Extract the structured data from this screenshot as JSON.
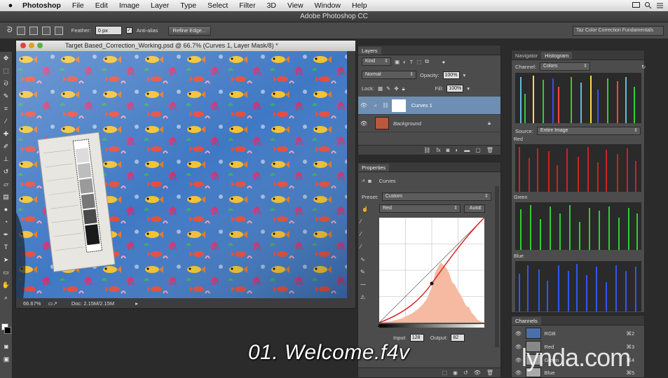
{
  "menubar": {
    "app": "Photoshop",
    "items": [
      "File",
      "Edit",
      "Image",
      "Layer",
      "Type",
      "Select",
      "Filter",
      "3D",
      "View",
      "Window",
      "Help"
    ]
  },
  "app_title": "Adobe Photoshop CC",
  "options": {
    "feather_label": "Feather:",
    "feather_value": "0 px",
    "antialias_label": "Anti-alias",
    "refine_edge": "Refine Edge...",
    "workspace": "Taz Color Correction Fundamentals"
  },
  "document": {
    "title": "Target Based_Correction_Working.psd @ 66.7% (Curves 1, Layer Mask/8) *",
    "zoom": "66.67%",
    "doc_size": "Doc: 2.15M/2.15M"
  },
  "layers": {
    "tab": "Layers",
    "kind": "Kind",
    "blend_mode": "Normal",
    "opacity_label": "Opacity:",
    "opacity": "100%",
    "lock_label": "Lock:",
    "fill_label": "Fill:",
    "fill": "100%",
    "items": [
      {
        "name": "Curves 1"
      },
      {
        "name": "Background"
      }
    ]
  },
  "properties": {
    "tab": "Properties",
    "title": "Curves",
    "preset_label": "Preset:",
    "preset": "Custom",
    "channel": "Red",
    "auto": "Auto",
    "input_label": "Input:",
    "input": "128",
    "output_label": "Output:",
    "output": "82"
  },
  "histogram": {
    "tabs": [
      "Navigator",
      "Histogram"
    ],
    "channel_label": "Channel:",
    "channel": "Colors",
    "source_label": "Source:",
    "source": "Entire Image",
    "labels": [
      "Red",
      "Green",
      "Blue"
    ]
  },
  "channels": {
    "tab": "Channels",
    "items": [
      {
        "name": "RGB",
        "shortcut": "⌘2"
      },
      {
        "name": "Red",
        "shortcut": "⌘3"
      },
      {
        "name": "Green",
        "shortcut": "⌘4"
      },
      {
        "name": "Blue",
        "shortcut": "⌘5"
      }
    ]
  },
  "watermark": "01. Welcome.f4v",
  "brand": "lynda.com"
}
